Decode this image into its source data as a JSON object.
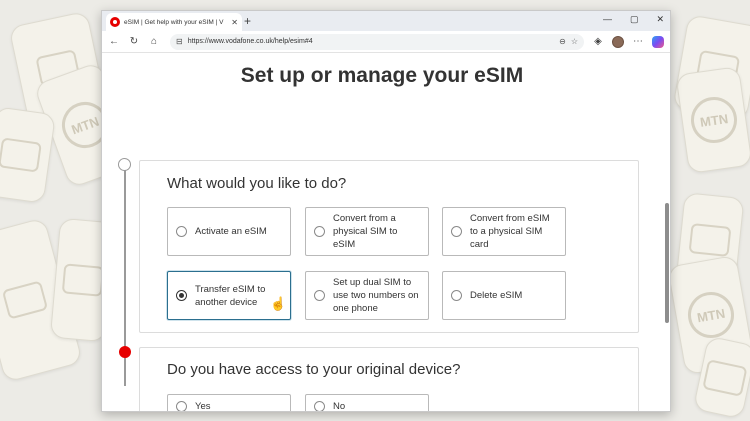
{
  "browser": {
    "tab_title": "eSIM | Get help with your eSIM | V",
    "tab_close": "✕",
    "new_tab": "+",
    "url": "https://www.vodafone.co.uk/help/esim#4",
    "window_controls": [
      "—",
      "▢",
      "✕"
    ]
  },
  "page": {
    "title": "Set up or manage your eSIM",
    "step1": {
      "question": "What would you like to do?",
      "options": [
        {
          "label": "Activate an eSIM",
          "selected": false
        },
        {
          "label": "Convert from a physical SIM to eSIM",
          "selected": false
        },
        {
          "label": "Convert from eSIM to a physical SIM card",
          "selected": false
        },
        {
          "label": "Transfer eSIM to another device",
          "selected": true
        },
        {
          "label": "Set up dual SIM to use two numbers on one phone",
          "selected": false
        },
        {
          "label": "Delete eSIM",
          "selected": false
        }
      ]
    },
    "step2": {
      "question": "Do you have access to your original device?",
      "options": [
        {
          "label": "Yes",
          "selected": false
        },
        {
          "label": "No",
          "selected": false
        }
      ]
    }
  },
  "background": {
    "sim_brand": "MTN"
  },
  "colors": {
    "accent_red": "#e60000",
    "selected_border": "#2b6f8f"
  }
}
